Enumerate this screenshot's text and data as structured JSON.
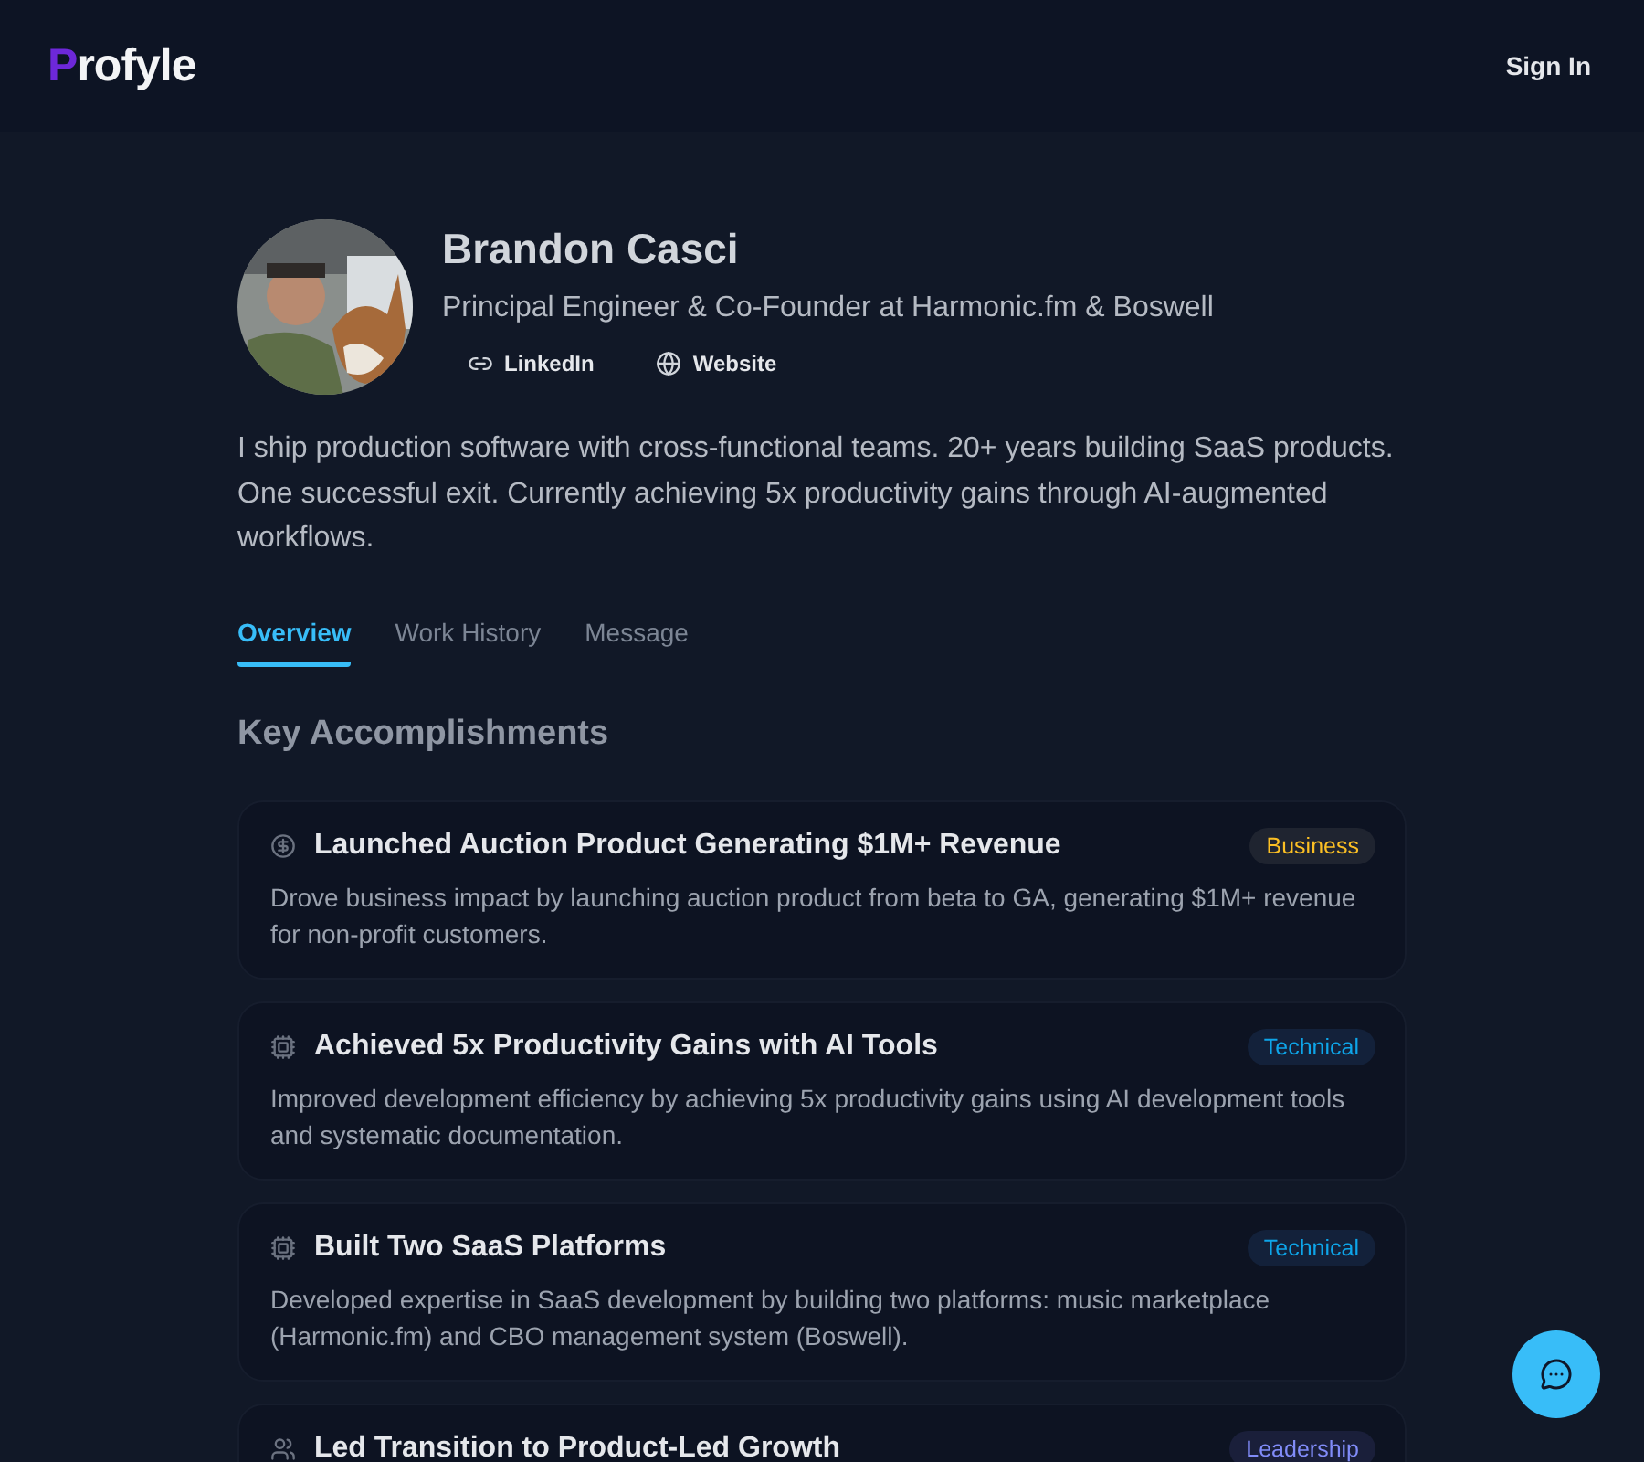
{
  "header": {
    "logo": {
      "accent": "P",
      "rest": "rofyle"
    },
    "sign_in": "Sign In"
  },
  "profile": {
    "name": "Brandon Casci",
    "headline": "Principal Engineer & Co-Founder at Harmonic.fm & Boswell",
    "links": [
      {
        "kind": "link",
        "label": "LinkedIn"
      },
      {
        "kind": "web",
        "label": "Website"
      }
    ],
    "bio": "I ship production software with cross-functional teams. 20+ years building SaaS products. One successful exit. Currently achieving 5x productivity gains through AI-augmented workflows."
  },
  "tabs": [
    {
      "label": "Overview",
      "selected": true
    },
    {
      "label": "Work History",
      "selected": false
    },
    {
      "label": "Message",
      "selected": false
    }
  ],
  "section_title": "Key Accomplishments",
  "accomplishments": [
    {
      "kind": "business",
      "title": "Launched Auction Product Generating $1M+ Revenue",
      "tag": "Business",
      "description": "Drove business impact by launching auction product from beta to GA, generating $1M+ revenue for non-profit customers."
    },
    {
      "kind": "technical",
      "title": "Achieved 5x Productivity Gains with AI Tools",
      "tag": "Technical",
      "description": "Improved development efficiency by achieving 5x productivity gains using AI development tools and systematic documentation."
    },
    {
      "kind": "technical",
      "title": "Built Two SaaS Platforms",
      "tag": "Technical",
      "description": "Developed expertise in SaaS development by building two platforms: music marketplace (Harmonic.fm) and CBO management system (Boswell)."
    },
    {
      "kind": "leadership",
      "title": "Led Transition to Product-Led Growth",
      "tag": "Leadership"
    }
  ]
}
